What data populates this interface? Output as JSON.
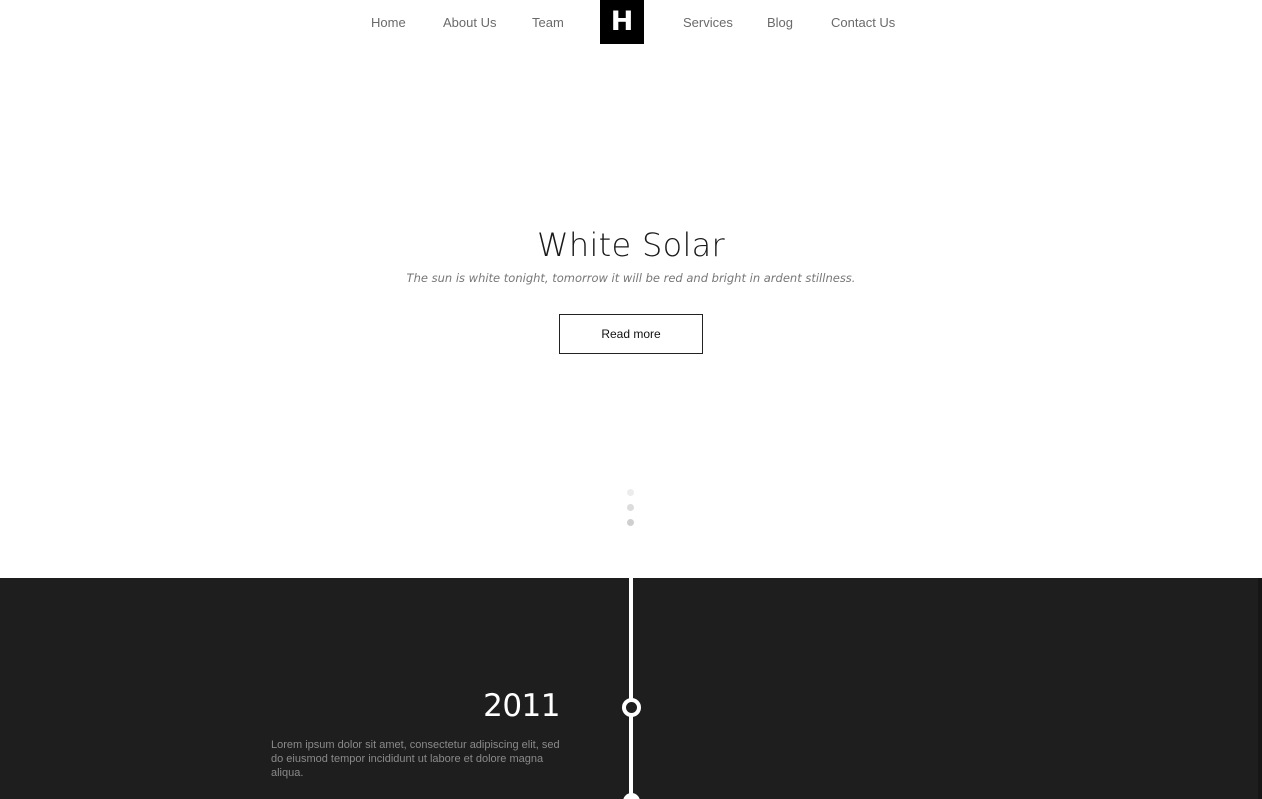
{
  "nav": {
    "items": [
      {
        "label": "Home"
      },
      {
        "label": "About Us"
      },
      {
        "label": "Team"
      },
      {
        "label": "Services"
      },
      {
        "label": "Blog"
      },
      {
        "label": "Contact Us"
      }
    ],
    "logo": "H"
  },
  "hero": {
    "title": "White Solar",
    "subtitle": "The sun is white tonight, tomorrow it will be red and bright in ardent stillness.",
    "button": "Read more"
  },
  "timeline": {
    "entries": [
      {
        "year": "2011",
        "text": "Lorem ipsum dolor sit amet, consectetur adipiscing elit, sed do eiusmod tempor incididunt ut labore et dolore magna aliqua."
      }
    ]
  },
  "colors": {
    "dark_bg": "#1e1e1e",
    "accent": "#000000",
    "nav_text": "#6a6a6a"
  }
}
